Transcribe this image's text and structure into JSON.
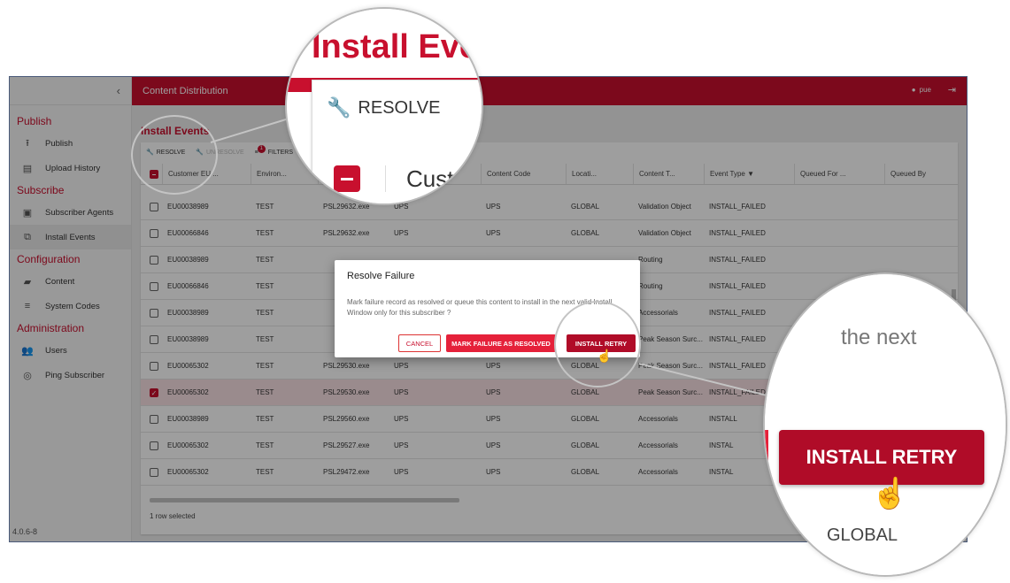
{
  "sidebar": {
    "collapse_glyph": "‹",
    "sections": [
      {
        "title": "Publish",
        "items": [
          {
            "label": "Publish",
            "icon": "publish-icon"
          },
          {
            "label": "Upload History",
            "icon": "history-icon"
          }
        ]
      },
      {
        "title": "Subscribe",
        "items": [
          {
            "label": "Subscriber Agents",
            "icon": "agent-icon"
          },
          {
            "label": "Install Events",
            "icon": "install-icon"
          }
        ]
      },
      {
        "title": "Configuration",
        "items": [
          {
            "label": "Content",
            "icon": "truck-icon"
          },
          {
            "label": "System Codes",
            "icon": "list-icon"
          }
        ]
      },
      {
        "title": "Administration",
        "items": [
          {
            "label": "Users",
            "icon": "users-icon"
          },
          {
            "label": "Ping Subscriber",
            "icon": "ping-icon"
          }
        ]
      }
    ],
    "version": "4.0.6-8"
  },
  "topbar": {
    "title": "Content Distribution",
    "user": "pue"
  },
  "page": {
    "title": "Install Events"
  },
  "toolbar": {
    "resolve": "RESOLVE",
    "unresolve": "UNRESOLVE",
    "filters": "FILTERS",
    "filter_count": "1"
  },
  "table": {
    "headers": [
      "Customer EU ...",
      "Environ...",
      "",
      "",
      "Content Code",
      "Locati...",
      "Content T...",
      "Event Type",
      "Queued For ...",
      "Queued By"
    ],
    "rows": [
      {
        "eu": "EU00038989",
        "env": "TEST",
        "file": "PSL29632.exe",
        "type": "UPS",
        "code": "UPS",
        "loc": "GLOBAL",
        "ctype": "Validation Object",
        "event": "INSTALL_FAILED",
        "checked": false
      },
      {
        "eu": "EU00066846",
        "env": "TEST",
        "file": "PSL29632.exe",
        "type": "UPS",
        "code": "UPS",
        "loc": "GLOBAL",
        "ctype": "Validation Object",
        "event": "INSTALL_FAILED",
        "checked": false
      },
      {
        "eu": "EU00038989",
        "env": "TEST",
        "file": "",
        "type": "",
        "code": "",
        "loc": "",
        "ctype": "Routing",
        "event": "INSTALL_FAILED",
        "checked": false
      },
      {
        "eu": "EU00066846",
        "env": "TEST",
        "file": "",
        "type": "",
        "code": "",
        "loc": "",
        "ctype": "Routing",
        "event": "INSTALL_FAILED",
        "checked": false
      },
      {
        "eu": "EU00038989",
        "env": "TEST",
        "file": "",
        "type": "",
        "code": "",
        "loc": "",
        "ctype": "Accessorials",
        "event": "INSTALL_FAILED",
        "checked": false
      },
      {
        "eu": "EU00038989",
        "env": "TEST",
        "file": "",
        "type": "",
        "code": "",
        "loc": "",
        "ctype": "Peak Season Surc...",
        "event": "INSTALL_FAILED",
        "checked": false
      },
      {
        "eu": "EU00065302",
        "env": "TEST",
        "file": "PSL29530.exe",
        "type": "UPS",
        "code": "UPS",
        "loc": "GLOBAL",
        "ctype": "Peak Season Surc...",
        "event": "INSTALL_FAILED",
        "checked": false
      },
      {
        "eu": "EU00065302",
        "env": "TEST",
        "file": "PSL29530.exe",
        "type": "UPS",
        "code": "UPS",
        "loc": "GLOBAL",
        "ctype": "Peak Season Surc...",
        "event": "INSTALL_FAILED",
        "checked": true
      },
      {
        "eu": "EU00038989",
        "env": "TEST",
        "file": "PSL29560.exe",
        "type": "UPS",
        "code": "UPS",
        "loc": "GLOBAL",
        "ctype": "Accessorials",
        "event": "INSTALL",
        "checked": false
      },
      {
        "eu": "EU00065302",
        "env": "TEST",
        "file": "PSL29527.exe",
        "type": "UPS",
        "code": "UPS",
        "loc": "GLOBAL",
        "ctype": "Accessorials",
        "event": "INSTAL",
        "checked": false
      },
      {
        "eu": "EU00065302",
        "env": "TEST",
        "file": "PSL29472.exe",
        "type": "UPS",
        "code": "UPS",
        "loc": "GLOBAL",
        "ctype": "Accessorials",
        "event": "INSTAL",
        "checked": false
      }
    ],
    "footer": "1 row selected"
  },
  "dialog": {
    "title": "Resolve Failure",
    "text": "Mark failure record as resolved or queue this content to install in the next valid Install Window only for this subscriber ?",
    "cancel": "CANCEL",
    "mark": "MARK FAILURE AS RESOLVED",
    "retry": "INSTALL RETRY"
  },
  "zoom1": {
    "title": "Install Eve",
    "resolve": "RESOLVE",
    "cust": "Cust"
  },
  "zoom2": {
    "text_top": "the next",
    "retry": "INSTALL RETRY",
    "global": "GLOBAL"
  },
  "colors": {
    "brand": "#c8102e",
    "retry": "#b00c28",
    "mark": "#e5213a"
  }
}
